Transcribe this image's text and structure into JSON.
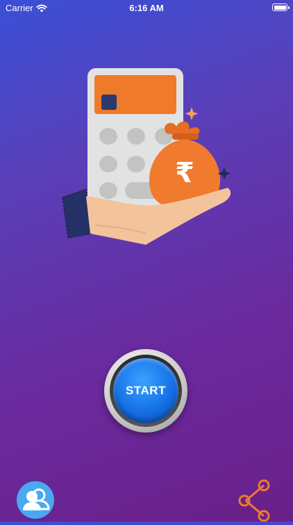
{
  "status_bar": {
    "carrier": "Carrier",
    "time": "6:16 AM",
    "icons": [
      "wifi-icon",
      "battery-icon"
    ]
  },
  "hero": {
    "illustration": "calculator-hand-money-bag-illustration",
    "currency_symbol": "₹"
  },
  "start_button": {
    "label": "START"
  },
  "bottom_bar": {
    "left_icon": "profile-icon",
    "right_icon": "share-icon"
  },
  "colors": {
    "gradient_top": "#3a4fd6",
    "gradient_bottom": "#6a1f88",
    "start_blue": "#1570e6",
    "accent_orange": "#f07a2e",
    "profile_blue": "#4aa8f0"
  }
}
